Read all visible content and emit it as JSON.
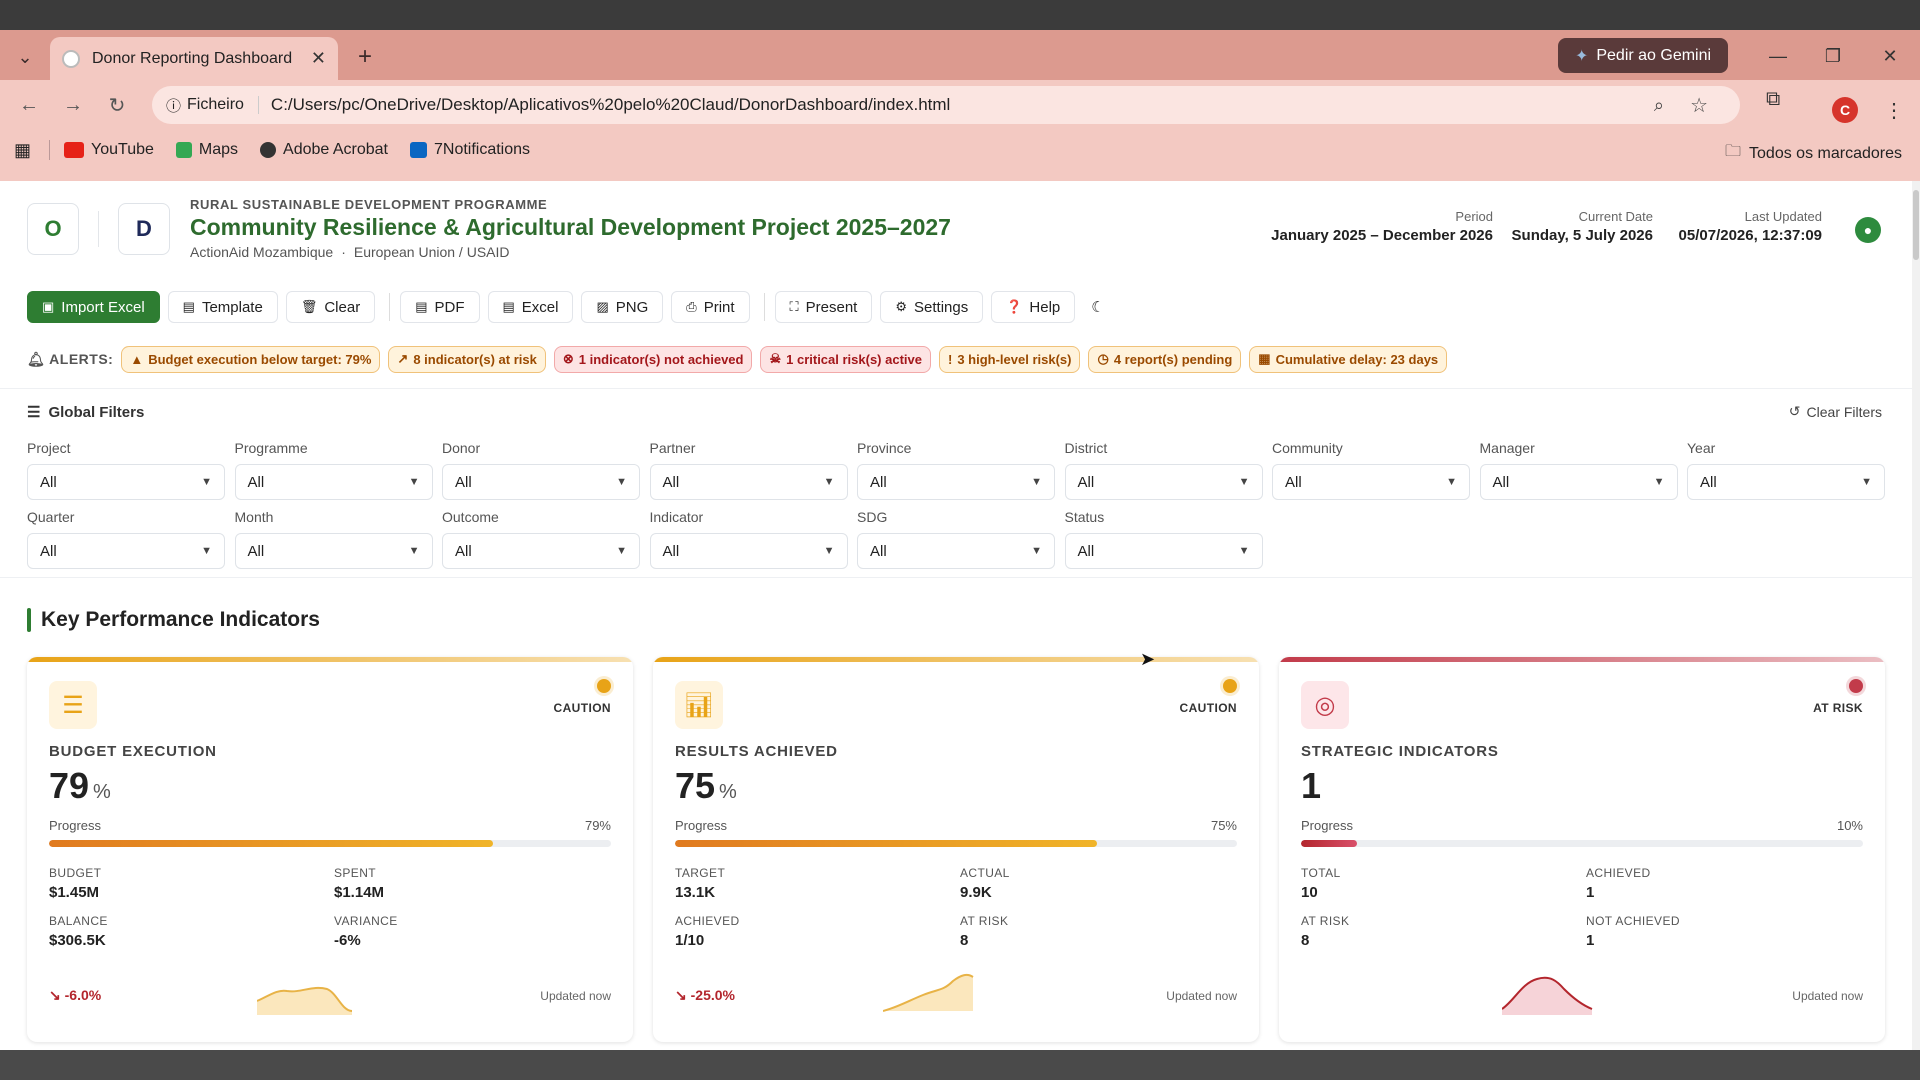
{
  "browser": {
    "tab_title": "Donor Reporting Dashboard",
    "gemini_label": "Pedir ao Gemini",
    "url_scheme": "Ficheiro",
    "url": "C:/Users/pc/OneDrive/Desktop/Aplicativos%20pelo%20Claud/DonorDashboard/index.html",
    "profile_initial": "C",
    "bookmarks": [
      {
        "label": "YouTube",
        "color": "#e62117"
      },
      {
        "label": "Maps",
        "color": "#34a853"
      },
      {
        "label": "Adobe Acrobat",
        "color": "#333333"
      },
      {
        "label": "7Notifications",
        "color": "#0a66c2"
      }
    ],
    "all_bookmarks": "Todos os marcadores"
  },
  "header": {
    "logo_left": "O",
    "logo_right": "D",
    "programme": "RURAL SUSTAINABLE DEVELOPMENT PROGRAMME",
    "title": "Community Resilience & Agricultural Development Project 2025–2027",
    "org": "ActionAid Mozambique",
    "donors": "European Union / USAID",
    "period_label": "Period",
    "period_value": "January 2025 – December 2026",
    "date_label": "Current Date",
    "date_value": "Sunday, 5 July 2026",
    "updated_label": "Last Updated",
    "updated_value": "05/07/2026, 12:37:09"
  },
  "toolbar": {
    "import": "Import Excel",
    "template": "Template",
    "clear": "Clear",
    "pdf": "PDF",
    "excel": "Excel",
    "png": "PNG",
    "print": "Print",
    "present": "Present",
    "settings": "Settings",
    "help": "Help"
  },
  "alerts": {
    "label": "ALERTS:",
    "items": [
      {
        "text": "Budget execution below target: 79%",
        "tone": "amber",
        "icon": "▲"
      },
      {
        "text": "8 indicator(s) at risk",
        "tone": "amber",
        "icon": "↗"
      },
      {
        "text": "1 indicator(s) not achieved",
        "tone": "red",
        "icon": "⊗"
      },
      {
        "text": "1 critical risk(s) active",
        "tone": "red",
        "icon": "☠"
      },
      {
        "text": "3 high-level risk(s)",
        "tone": "amber",
        "icon": "!"
      },
      {
        "text": "4 report(s) pending",
        "tone": "amber",
        "icon": "◷"
      },
      {
        "text": "Cumulative delay: 23 days",
        "tone": "amber",
        "icon": "▦"
      }
    ]
  },
  "filters": {
    "title": "Global Filters",
    "clear": "Clear Filters",
    "fields": [
      {
        "label": "Project",
        "value": "All"
      },
      {
        "label": "Programme",
        "value": "All"
      },
      {
        "label": "Donor",
        "value": "All"
      },
      {
        "label": "Partner",
        "value": "All"
      },
      {
        "label": "Province",
        "value": "All"
      },
      {
        "label": "District",
        "value": "All"
      },
      {
        "label": "Community",
        "value": "All"
      },
      {
        "label": "Manager",
        "value": "All"
      },
      {
        "label": "Year",
        "value": "All"
      },
      {
        "label": "Quarter",
        "value": "All"
      },
      {
        "label": "Month",
        "value": "All"
      },
      {
        "label": "Outcome",
        "value": "All"
      },
      {
        "label": "Indicator",
        "value": "All"
      },
      {
        "label": "SDG",
        "value": "All"
      },
      {
        "label": "Status",
        "value": "All"
      }
    ]
  },
  "kpi": {
    "title": "Key Performance Indicators",
    "cards": [
      {
        "title": "BUDGET EXECUTION",
        "value": "79",
        "unit": "%",
        "status": "CAUTION",
        "color": "#e8a317",
        "progress_label": "Progress",
        "progress_text": "79%",
        "progress": 0.79,
        "stats": [
          {
            "label": "BUDGET",
            "value": "$1.45M"
          },
          {
            "label": "SPENT",
            "value": "$1.14M"
          },
          {
            "label": "BALANCE",
            "value": "$306.5K"
          },
          {
            "label": "VARIANCE",
            "value": "-6%"
          }
        ],
        "trend": "↘ -6.0%",
        "updated": "Updated now",
        "icon": "coins-icon"
      },
      {
        "title": "RESULTS ACHIEVED",
        "value": "75",
        "unit": "%",
        "status": "CAUTION",
        "color": "#e8a317",
        "progress_label": "Progress",
        "progress_text": "75%",
        "progress": 0.75,
        "stats": [
          {
            "label": "TARGET",
            "value": "13.1K"
          },
          {
            "label": "ACTUAL",
            "value": "9.9K"
          },
          {
            "label": "ACHIEVED",
            "value": "1/10"
          },
          {
            "label": "AT RISK",
            "value": "8"
          }
        ],
        "trend": "↘ -25.0%",
        "updated": "Updated now",
        "icon": "bar-chart-icon"
      },
      {
        "title": "STRATEGIC INDICATORS",
        "value": "1",
        "unit": "",
        "status": "AT RISK",
        "color": "#c23b4a",
        "progress_label": "Progress",
        "progress_text": "10%",
        "progress": 0.1,
        "stats": [
          {
            "label": "TOTAL",
            "value": "10"
          },
          {
            "label": "ACHIEVED",
            "value": "1"
          },
          {
            "label": "AT RISK",
            "value": "8"
          },
          {
            "label": "NOT ACHIEVED",
            "value": "1"
          }
        ],
        "trend": "",
        "updated": "Updated now",
        "icon": "target-icon"
      }
    ]
  }
}
